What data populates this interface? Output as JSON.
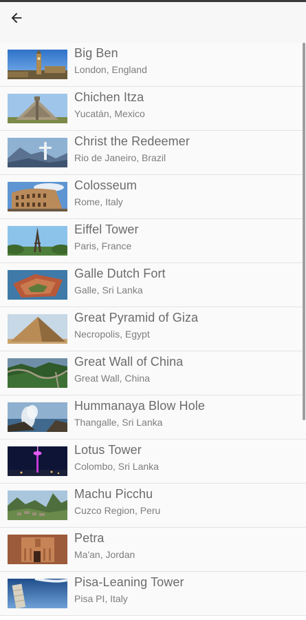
{
  "app_bar": {
    "back_icon": "arrow-left-icon"
  },
  "places": [
    {
      "name": "Big Ben",
      "location": "London, England"
    },
    {
      "name": "Chichen Itza",
      "location": "Yucatán, Mexico"
    },
    {
      "name": "Christ the Redeemer",
      "location": "Rio de Janeiro, Brazil"
    },
    {
      "name": "Colosseum",
      "location": "Rome, Italy"
    },
    {
      "name": "Eiffel Tower",
      "location": "Paris, France"
    },
    {
      "name": "Galle Dutch Fort",
      "location": "Galle, Sri Lanka"
    },
    {
      "name": "Great Pyramid of Giza",
      "location": "Necropolis, Egypt"
    },
    {
      "name": "Great Wall of China",
      "location": "Great Wall, China"
    },
    {
      "name": "Hummanaya Blow Hole",
      "location": "Thangalle, Sri Lanka"
    },
    {
      "name": "Lotus Tower",
      "location": "Colombo, Sri Lanka"
    },
    {
      "name": "Machu Picchu",
      "location": "Cuzco Region, Peru"
    },
    {
      "name": "Petra",
      "location": "Ma'an, Jordan"
    },
    {
      "name": "Pisa-Leaning Tower",
      "location": "Pisa PI, Italy"
    }
  ]
}
